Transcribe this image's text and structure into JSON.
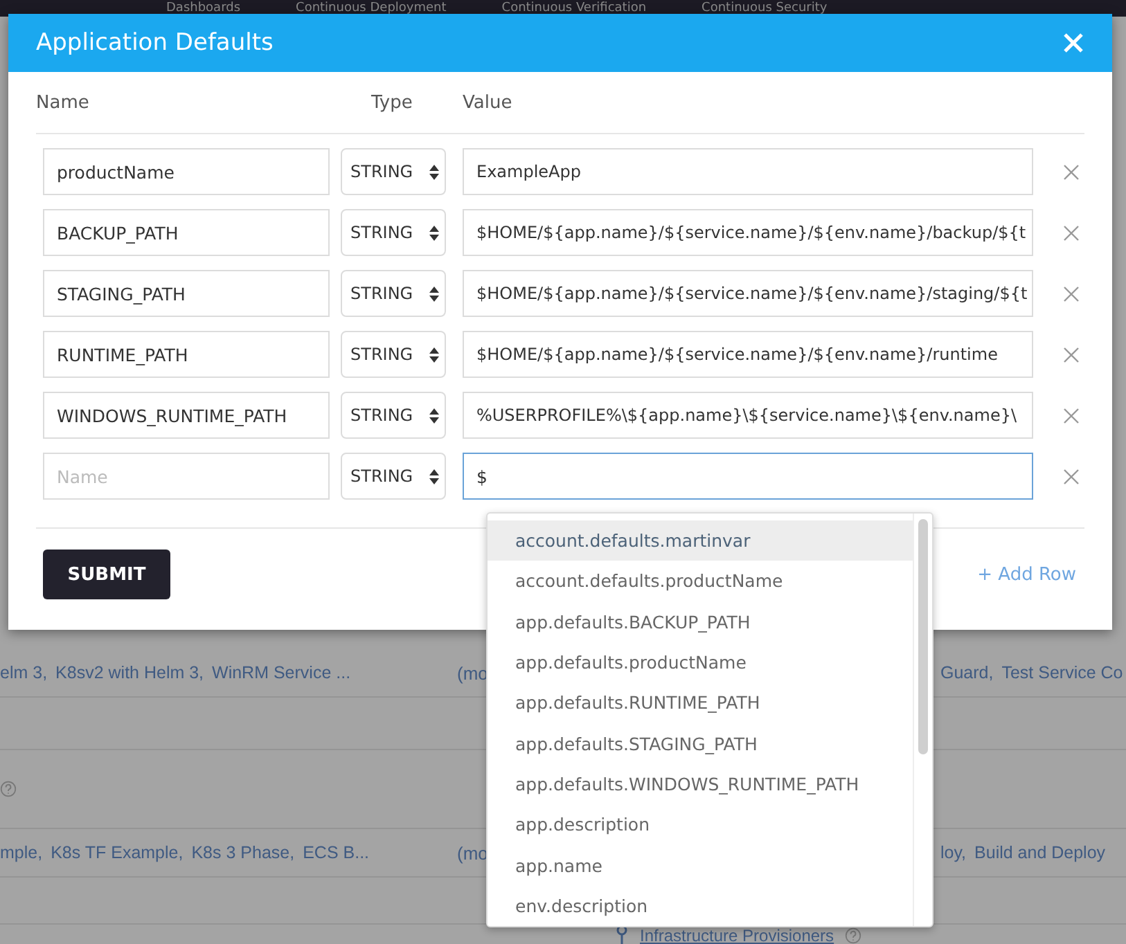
{
  "top_nav": [
    "Dashboards",
    "Continuous Deployment",
    "Continuous Verification",
    "Continuous Security"
  ],
  "background_rows": [
    {
      "left_links": [
        "elm 3,",
        "K8sv2 with Helm 3,",
        "WinRM Service ..."
      ],
      "middle": "(mo",
      "right_links": [
        "Guard,",
        "Test Service Co"
      ]
    },
    {
      "left_links": [
        "mple,",
        "K8s TF Example,",
        "K8s 3 Phase,",
        "ECS B..."
      ],
      "middle": "(mo",
      "right_links": [
        "loy,",
        "Build and Deploy"
      ]
    }
  ],
  "background_footer": "Infrastructure Provisioners",
  "dialog": {
    "title": "Application Defaults",
    "columns": [
      "Name",
      "Type",
      "Value"
    ],
    "rows": [
      {
        "name": "productName",
        "type": "STRING",
        "value": "ExampleApp",
        "focused": false
      },
      {
        "name": "BACKUP_PATH",
        "type": "STRING",
        "value": "$HOME/${app.name}/${service.name}/${env.name}/backup/${t",
        "focused": false
      },
      {
        "name": "STAGING_PATH",
        "type": "STRING",
        "value": "$HOME/${app.name}/${service.name}/${env.name}/staging/${t",
        "focused": false
      },
      {
        "name": "RUNTIME_PATH",
        "type": "STRING",
        "value": "$HOME/${app.name}/${service.name}/${env.name}/runtime",
        "focused": false
      },
      {
        "name": "WINDOWS_RUNTIME_PATH",
        "type": "STRING",
        "value": "%USERPROFILE%\\${app.name}\\${service.name}\\${env.name}\\",
        "focused": false
      },
      {
        "placeholder": "Name",
        "type": "STRING",
        "value": "$",
        "focused": true
      }
    ],
    "submit": "SUBMIT",
    "add_row": "+ Add Row"
  },
  "suggestions": [
    {
      "label": "account.defaults.martinvar",
      "selected": true
    },
    {
      "label": "account.defaults.productName",
      "selected": false
    },
    {
      "label": "app.defaults.BACKUP_PATH",
      "selected": false
    },
    {
      "label": "app.defaults.productName",
      "selected": false
    },
    {
      "label": "app.defaults.RUNTIME_PATH",
      "selected": false
    },
    {
      "label": "app.defaults.STAGING_PATH",
      "selected": false
    },
    {
      "label": "app.defaults.WINDOWS_RUNTIME_PATH",
      "selected": false
    },
    {
      "label": "app.description",
      "selected": false
    },
    {
      "label": "app.name",
      "selected": false
    },
    {
      "label": "env.description",
      "selected": false
    }
  ]
}
